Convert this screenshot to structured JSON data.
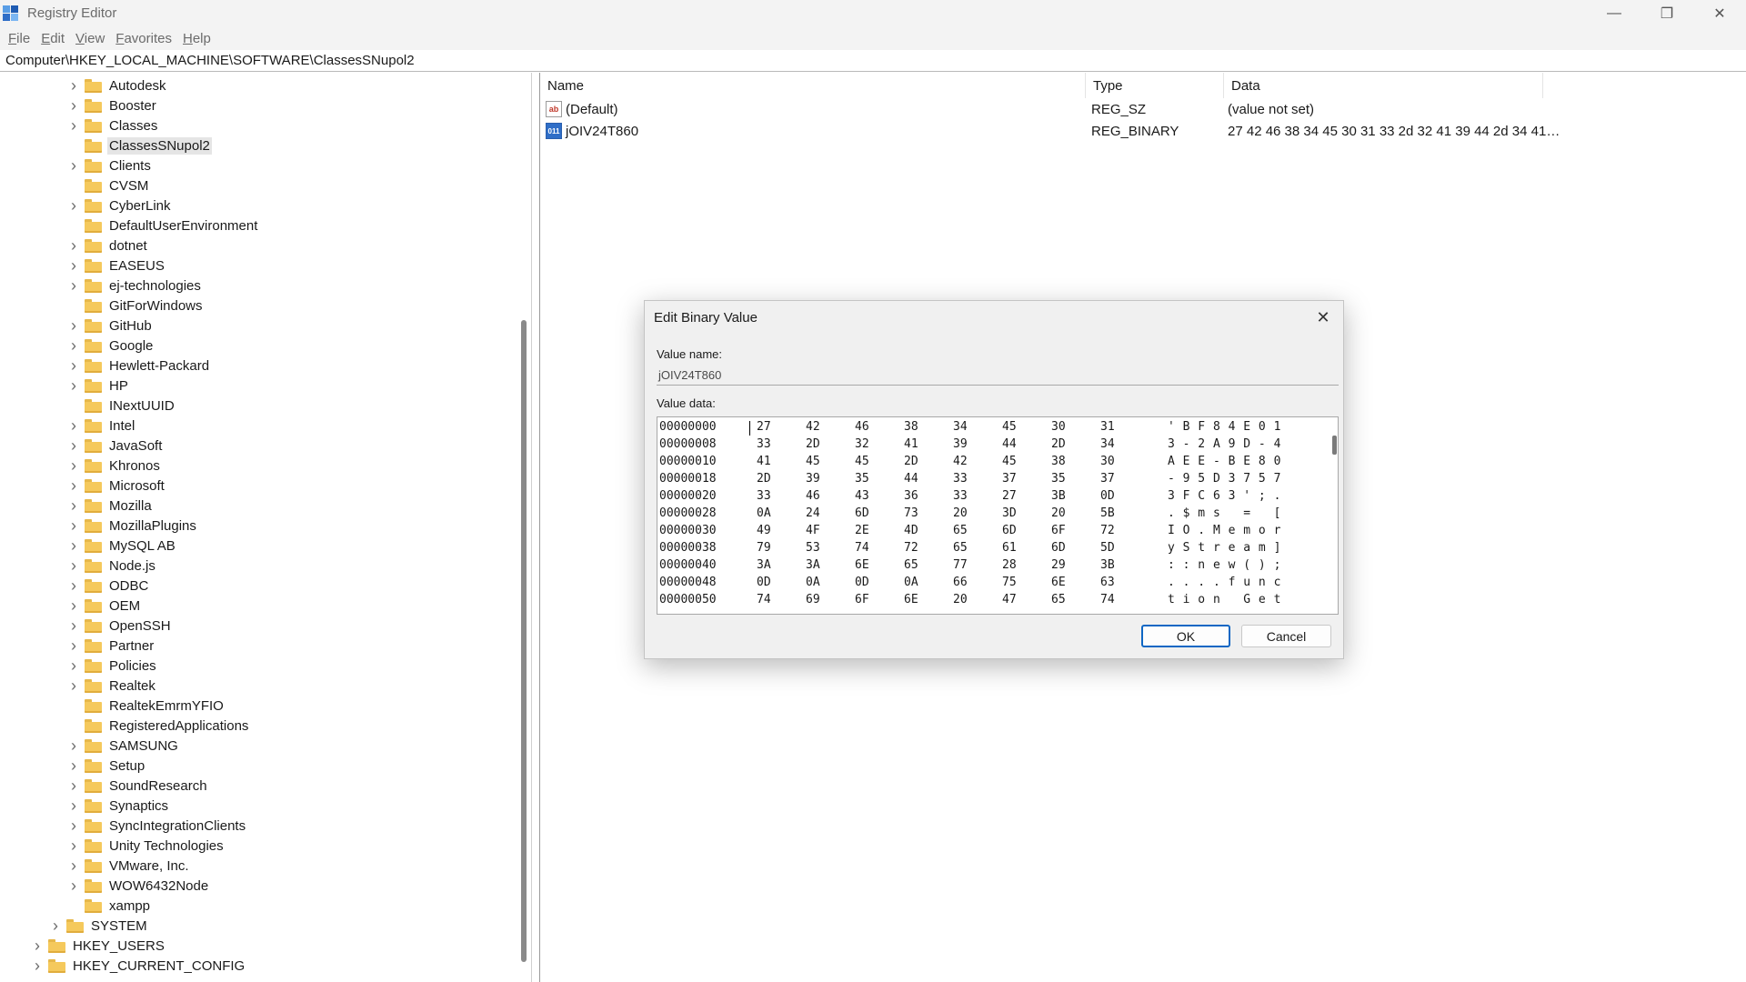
{
  "window": {
    "title": "Registry Editor",
    "controls": {
      "minimize": "—",
      "maximize": "❐",
      "close": "✕"
    }
  },
  "menu": {
    "items": [
      {
        "first": "F",
        "rest": "ile"
      },
      {
        "first": "E",
        "rest": "dit"
      },
      {
        "first": "V",
        "rest": "iew"
      },
      {
        "first": "F",
        "rest": "avorites"
      },
      {
        "first": "H",
        "rest": "elp"
      }
    ]
  },
  "address": {
    "path": "Computer\\HKEY_LOCAL_MACHINE\\SOFTWARE\\ClassesSNupol2"
  },
  "tree": {
    "items": [
      {
        "label": "Autodesk",
        "expandable": true,
        "level": 3
      },
      {
        "label": "Booster",
        "expandable": true,
        "level": 3
      },
      {
        "label": "Classes",
        "expandable": true,
        "level": 3
      },
      {
        "label": "ClassesSNupol2",
        "expandable": false,
        "level": 3,
        "selected": true
      },
      {
        "label": "Clients",
        "expandable": true,
        "level": 3
      },
      {
        "label": "CVSM",
        "expandable": false,
        "level": 3
      },
      {
        "label": "CyberLink",
        "expandable": true,
        "level": 3
      },
      {
        "label": "DefaultUserEnvironment",
        "expandable": false,
        "level": 3
      },
      {
        "label": "dotnet",
        "expandable": true,
        "level": 3
      },
      {
        "label": "EASEUS",
        "expandable": true,
        "level": 3
      },
      {
        "label": "ej-technologies",
        "expandable": true,
        "level": 3
      },
      {
        "label": "GitForWindows",
        "expandable": false,
        "level": 3
      },
      {
        "label": "GitHub",
        "expandable": true,
        "level": 3
      },
      {
        "label": "Google",
        "expandable": true,
        "level": 3
      },
      {
        "label": "Hewlett-Packard",
        "expandable": true,
        "level": 3
      },
      {
        "label": "HP",
        "expandable": true,
        "level": 3
      },
      {
        "label": "INextUUID",
        "expandable": false,
        "level": 3
      },
      {
        "label": "Intel",
        "expandable": true,
        "level": 3
      },
      {
        "label": "JavaSoft",
        "expandable": true,
        "level": 3
      },
      {
        "label": "Khronos",
        "expandable": true,
        "level": 3
      },
      {
        "label": "Microsoft",
        "expandable": true,
        "level": 3
      },
      {
        "label": "Mozilla",
        "expandable": true,
        "level": 3
      },
      {
        "label": "MozillaPlugins",
        "expandable": true,
        "level": 3
      },
      {
        "label": "MySQL AB",
        "expandable": true,
        "level": 3
      },
      {
        "label": "Node.js",
        "expandable": true,
        "level": 3
      },
      {
        "label": "ODBC",
        "expandable": true,
        "level": 3
      },
      {
        "label": "OEM",
        "expandable": true,
        "level": 3
      },
      {
        "label": "OpenSSH",
        "expandable": true,
        "level": 3
      },
      {
        "label": "Partner",
        "expandable": true,
        "level": 3
      },
      {
        "label": "Policies",
        "expandable": true,
        "level": 3
      },
      {
        "label": "Realtek",
        "expandable": true,
        "level": 3
      },
      {
        "label": "RealtekEmrmYFIO",
        "expandable": false,
        "level": 3
      },
      {
        "label": "RegisteredApplications",
        "expandable": false,
        "level": 3
      },
      {
        "label": "SAMSUNG",
        "expandable": true,
        "level": 3
      },
      {
        "label": "Setup",
        "expandable": true,
        "level": 3
      },
      {
        "label": "SoundResearch",
        "expandable": true,
        "level": 3
      },
      {
        "label": "Synaptics",
        "expandable": true,
        "level": 3
      },
      {
        "label": "SyncIntegrationClients",
        "expandable": true,
        "level": 3
      },
      {
        "label": "Unity Technologies",
        "expandable": true,
        "level": 3
      },
      {
        "label": "VMware, Inc.",
        "expandable": true,
        "level": 3
      },
      {
        "label": "WOW6432Node",
        "expandable": true,
        "level": 3
      },
      {
        "label": "xampp",
        "expandable": false,
        "level": 3
      },
      {
        "label": "SYSTEM",
        "expandable": true,
        "level": 2
      },
      {
        "label": "HKEY_USERS",
        "expandable": true,
        "level": 1
      },
      {
        "label": "HKEY_CURRENT_CONFIG",
        "expandable": true,
        "level": 1
      }
    ]
  },
  "list": {
    "columns": {
      "name": "Name",
      "type": "Type",
      "data": "Data"
    },
    "rows": [
      {
        "icon": "string-value-icon",
        "glyph": "ab",
        "name": "(Default)",
        "type": "REG_SZ",
        "data": "(value not set)"
      },
      {
        "icon": "binary-value-icon",
        "glyph": "011",
        "name": "jOIV24T860",
        "type": "REG_BINARY",
        "data": "27 42 46 38 34 45 30 31 33 2d 32 41 39 44 2d 34 41…"
      }
    ]
  },
  "dialog": {
    "title": "Edit Binary Value",
    "close_glyph": "✕",
    "value_name_label": "Value name:",
    "value_name": "jOIV24T860",
    "value_data_label": "Value data:",
    "hex_rows": [
      {
        "addr": "00000000",
        "bytes": [
          "27",
          "42",
          "46",
          "38",
          "34",
          "45",
          "30",
          "31"
        ],
        "ascii": "' B F 8 4 E 0 1"
      },
      {
        "addr": "00000008",
        "bytes": [
          "33",
          "2D",
          "32",
          "41",
          "39",
          "44",
          "2D",
          "34"
        ],
        "ascii": "3 - 2 A 9 D - 4"
      },
      {
        "addr": "00000010",
        "bytes": [
          "41",
          "45",
          "45",
          "2D",
          "42",
          "45",
          "38",
          "30"
        ],
        "ascii": "A E E - B E 8 0"
      },
      {
        "addr": "00000018",
        "bytes": [
          "2D",
          "39",
          "35",
          "44",
          "33",
          "37",
          "35",
          "37"
        ],
        "ascii": "- 9 5 D 3 7 5 7"
      },
      {
        "addr": "00000020",
        "bytes": [
          "33",
          "46",
          "43",
          "36",
          "33",
          "27",
          "3B",
          "0D"
        ],
        "ascii": "3 F C 6 3 ' ; ."
      },
      {
        "addr": "00000028",
        "bytes": [
          "0A",
          "24",
          "6D",
          "73",
          "20",
          "3D",
          "20",
          "5B"
        ],
        "ascii": ". $ m s   =   ["
      },
      {
        "addr": "00000030",
        "bytes": [
          "49",
          "4F",
          "2E",
          "4D",
          "65",
          "6D",
          "6F",
          "72"
        ],
        "ascii": "I O . M e m o r"
      },
      {
        "addr": "00000038",
        "bytes": [
          "79",
          "53",
          "74",
          "72",
          "65",
          "61",
          "6D",
          "5D"
        ],
        "ascii": "y S t r e a m ]"
      },
      {
        "addr": "00000040",
        "bytes": [
          "3A",
          "3A",
          "6E",
          "65",
          "77",
          "28",
          "29",
          "3B"
        ],
        "ascii": ": : n e w ( ) ;"
      },
      {
        "addr": "00000048",
        "bytes": [
          "0D",
          "0A",
          "0D",
          "0A",
          "66",
          "75",
          "6E",
          "63"
        ],
        "ascii": ". . . . f u n c"
      },
      {
        "addr": "00000050",
        "bytes": [
          "74",
          "69",
          "6F",
          "6E",
          "20",
          "47",
          "65",
          "74"
        ],
        "ascii": "t i o n   G e t"
      }
    ],
    "ok_label": "OK",
    "cancel_label": "Cancel"
  }
}
